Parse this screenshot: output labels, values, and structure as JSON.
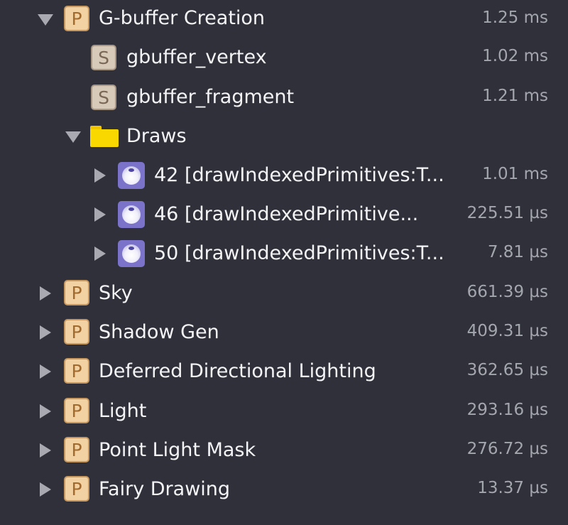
{
  "tree": {
    "gbuffer": {
      "icon": "pipeline-state-icon",
      "badge_letter": "P",
      "label": "G-buffer Creation",
      "time": "1.25 ms",
      "expanded": true
    },
    "gbuffer_vertex": {
      "icon": "shader-icon",
      "badge_letter": "S",
      "label": "gbuffer_vertex",
      "time": "1.02 ms"
    },
    "gbuffer_fragment": {
      "icon": "shader-icon",
      "badge_letter": "S",
      "label": "gbuffer_fragment",
      "time": "1.21 ms"
    },
    "draws": {
      "icon": "folder-icon",
      "label": "Draws",
      "expanded": true
    },
    "draw_calls": [
      {
        "icon": "draw-call-icon",
        "label": "42 [drawIndexedPrimitives:T...",
        "time": "1.01 ms"
      },
      {
        "icon": "draw-call-icon",
        "label": "46 [drawIndexedPrimitive...",
        "time": "225.51 µs"
      },
      {
        "icon": "draw-call-icon",
        "label": "50 [drawIndexedPrimitives:T...",
        "time": "7.81 µs"
      }
    ],
    "pipelines": [
      {
        "icon": "pipeline-state-icon",
        "badge_letter": "P",
        "label": "Sky",
        "time": "661.39 µs"
      },
      {
        "icon": "pipeline-state-icon",
        "badge_letter": "P",
        "label": "Shadow Gen",
        "time": "409.31 µs"
      },
      {
        "icon": "pipeline-state-icon",
        "badge_letter": "P",
        "label": "Deferred Directional Lighting",
        "time": "362.65 µs"
      },
      {
        "icon": "pipeline-state-icon",
        "badge_letter": "P",
        "label": "Light",
        "time": "293.16 µs"
      },
      {
        "icon": "pipeline-state-icon",
        "badge_letter": "P",
        "label": "Point Light Mask",
        "time": "276.72 µs"
      },
      {
        "icon": "pipeline-state-icon",
        "badge_letter": "P",
        "label": "Fairy Drawing",
        "time": "13.37 µs"
      }
    ]
  },
  "colors": {
    "background": "#2f3039",
    "text": "#f4f4f6",
    "time_text": "#a4a6ae",
    "disclosure": "#a9aab1",
    "pipeline_badge": "#f2d1a2",
    "shader_badge": "#d7cab9",
    "draw_call_icon": "#7a73c9",
    "folder": "#f9d800"
  }
}
